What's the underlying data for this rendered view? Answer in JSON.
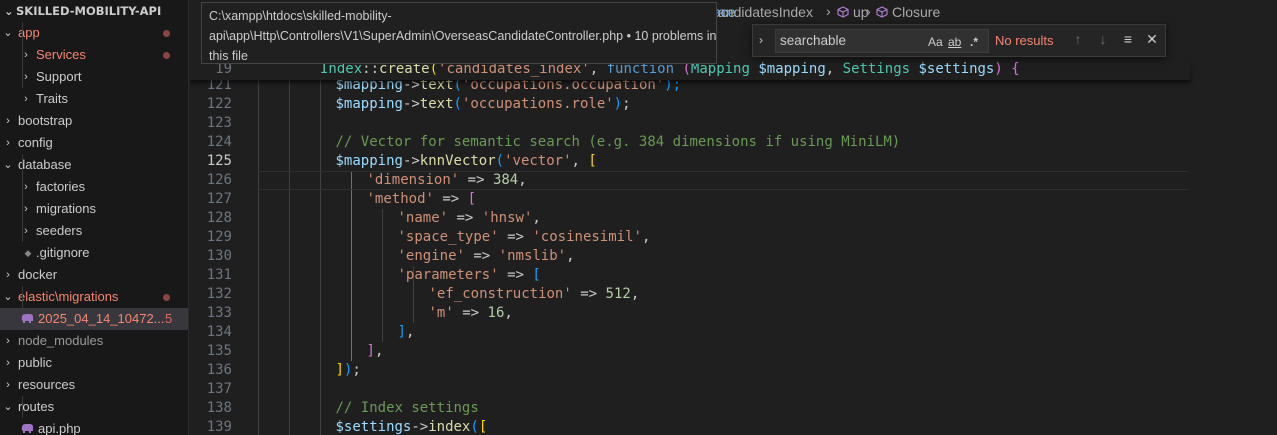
{
  "explorer": {
    "root_label": "SKILLED-MOBILITY-API",
    "items": [
      {
        "label": "app",
        "depth": 0,
        "state": "open",
        "tone": "red",
        "badge": "dot"
      },
      {
        "label": "Services",
        "depth": 1,
        "state": "closed",
        "tone": "red",
        "badge": "dot"
      },
      {
        "label": "Support",
        "depth": 1,
        "state": "closed",
        "tone": "normal",
        "badge": ""
      },
      {
        "label": "Traits",
        "depth": 1,
        "state": "closed",
        "tone": "normal",
        "badge": ""
      },
      {
        "label": "bootstrap",
        "depth": 0,
        "state": "closed",
        "tone": "normal",
        "badge": ""
      },
      {
        "label": "config",
        "depth": 0,
        "state": "closed",
        "tone": "normal",
        "badge": ""
      },
      {
        "label": "database",
        "depth": 0,
        "state": "open",
        "tone": "normal",
        "badge": ""
      },
      {
        "label": "factories",
        "depth": 1,
        "state": "closed",
        "tone": "normal",
        "badge": ""
      },
      {
        "label": "migrations",
        "depth": 1,
        "state": "closed",
        "tone": "normal",
        "badge": ""
      },
      {
        "label": "seeders",
        "depth": 1,
        "state": "closed",
        "tone": "normal",
        "badge": ""
      },
      {
        "label": ".gitignore",
        "depth": 1,
        "state": "file",
        "tone": "normal",
        "badge": ""
      },
      {
        "label": "docker",
        "depth": 0,
        "state": "closed",
        "tone": "normal",
        "badge": ""
      },
      {
        "label": "elastic\\migrations",
        "depth": 0,
        "state": "open",
        "tone": "red",
        "badge": "dot"
      },
      {
        "label": "2025_04_14_10472...",
        "depth": 1,
        "state": "php",
        "tone": "red",
        "badge": "5"
      },
      {
        "label": "node_modules",
        "depth": 0,
        "state": "closed",
        "tone": "muted",
        "badge": ""
      },
      {
        "label": "public",
        "depth": 0,
        "state": "closed",
        "tone": "normal",
        "badge": ""
      },
      {
        "label": "resources",
        "depth": 0,
        "state": "closed",
        "tone": "normal",
        "badge": ""
      },
      {
        "label": "routes",
        "depth": 0,
        "state": "open",
        "tone": "normal",
        "badge": ""
      },
      {
        "label": "api.php",
        "depth": 1,
        "state": "php",
        "tone": "normal",
        "badge": ""
      }
    ]
  },
  "breadcrumbs": {
    "partial_left": "ace",
    "items": [
      "andidatesIndex",
      "up",
      "Closure"
    ]
  },
  "tooltip": {
    "lines": [
      "C:\\xampp\\htdocs\\skilled-mobility-",
      "api\\app\\Http\\Controllers\\V1\\SuperAdmin\\OverseasCandidateController.php • 10 problems in",
      "this file"
    ]
  },
  "find": {
    "value": "searchable",
    "match_case_label": "Aa",
    "whole_word_label": "ab",
    "regex_label": ".*",
    "status": "No results"
  },
  "sticky": {
    "number": "19",
    "tokens": [
      {
        "t": "Index",
        "c": "cls"
      },
      {
        "t": "::",
        "c": "op"
      },
      {
        "t": "create",
        "c": "fn"
      },
      {
        "t": "(",
        "c": "br1"
      },
      {
        "t": "'candidates_index'",
        "c": "str"
      },
      {
        "t": ", ",
        "c": "op"
      },
      {
        "t": "function ",
        "c": "kw"
      },
      {
        "t": "(",
        "c": "br2"
      },
      {
        "t": "Mapping ",
        "c": "cls"
      },
      {
        "t": "$mapping",
        "c": "var"
      },
      {
        "t": ", ",
        "c": "op"
      },
      {
        "t": "Settings ",
        "c": "cls"
      },
      {
        "t": "$settings",
        "c": "var"
      },
      {
        "t": ") ",
        "c": "br2"
      },
      {
        "t": "{",
        "c": "br2"
      }
    ]
  },
  "code": [
    {
      "n": "121",
      "indent": 10,
      "tokens": [
        {
          "t": "$mapping",
          "c": "var"
        },
        {
          "t": "->",
          "c": "op"
        },
        {
          "t": "text",
          "c": "fn"
        },
        {
          "t": "(",
          "c": "br3"
        },
        {
          "t": "'occupations.occupation'",
          "c": "str"
        },
        {
          "t": ");",
          "c": "br3"
        }
      ]
    },
    {
      "n": "122",
      "indent": 10,
      "tokens": [
        {
          "t": "$mapping",
          "c": "var"
        },
        {
          "t": "->",
          "c": "op"
        },
        {
          "t": "text",
          "c": "fn"
        },
        {
          "t": "(",
          "c": "br3"
        },
        {
          "t": "'occupations.role'",
          "c": "str"
        },
        {
          "t": ")",
          "c": "br3"
        },
        {
          "t": ";",
          "c": "op"
        }
      ]
    },
    {
      "n": "123",
      "indent": 0,
      "tokens": []
    },
    {
      "n": "124",
      "indent": 10,
      "tokens": [
        {
          "t": "// Vector for semantic search (e.g. 384 dimensions if using MiniLM)",
          "c": "com"
        }
      ]
    },
    {
      "n": "125",
      "indent": 10,
      "tokens": [
        {
          "t": "$mapping",
          "c": "var"
        },
        {
          "t": "->",
          "c": "op"
        },
        {
          "t": "knnVector",
          "c": "fn"
        },
        {
          "t": "(",
          "c": "br3"
        },
        {
          "t": "'vector'",
          "c": "str"
        },
        {
          "t": ", ",
          "c": "op"
        },
        {
          "t": "[",
          "c": "br1"
        }
      ]
    },
    {
      "n": "126",
      "indent": 14,
      "tokens": [
        {
          "t": "'dimension'",
          "c": "str"
        },
        {
          "t": " => ",
          "c": "op"
        },
        {
          "t": "384",
          "c": "num"
        },
        {
          "t": ",",
          "c": "op"
        }
      ]
    },
    {
      "n": "127",
      "indent": 14,
      "tokens": [
        {
          "t": "'method'",
          "c": "str"
        },
        {
          "t": " => ",
          "c": "op"
        },
        {
          "t": "[",
          "c": "br2"
        }
      ]
    },
    {
      "n": "128",
      "indent": 18,
      "tokens": [
        {
          "t": "'name'",
          "c": "str"
        },
        {
          "t": " => ",
          "c": "op"
        },
        {
          "t": "'hnsw'",
          "c": "str"
        },
        {
          "t": ",",
          "c": "op"
        }
      ]
    },
    {
      "n": "129",
      "indent": 18,
      "tokens": [
        {
          "t": "'space_type'",
          "c": "str"
        },
        {
          "t": " => ",
          "c": "op"
        },
        {
          "t": "'cosinesimil'",
          "c": "str"
        },
        {
          "t": ",",
          "c": "op"
        }
      ]
    },
    {
      "n": "130",
      "indent": 18,
      "tokens": [
        {
          "t": "'engine'",
          "c": "str"
        },
        {
          "t": " => ",
          "c": "op"
        },
        {
          "t": "'nmslib'",
          "c": "str"
        },
        {
          "t": ",",
          "c": "op"
        }
      ]
    },
    {
      "n": "131",
      "indent": 18,
      "tokens": [
        {
          "t": "'parameters'",
          "c": "str"
        },
        {
          "t": " => ",
          "c": "op"
        },
        {
          "t": "[",
          "c": "br3"
        }
      ]
    },
    {
      "n": "132",
      "indent": 22,
      "tokens": [
        {
          "t": "'ef_construction'",
          "c": "str"
        },
        {
          "t": " => ",
          "c": "op"
        },
        {
          "t": "512",
          "c": "num"
        },
        {
          "t": ",",
          "c": "op"
        }
      ]
    },
    {
      "n": "133",
      "indent": 22,
      "tokens": [
        {
          "t": "'m'",
          "c": "str"
        },
        {
          "t": " => ",
          "c": "op"
        },
        {
          "t": "16",
          "c": "num"
        },
        {
          "t": ",",
          "c": "op"
        }
      ]
    },
    {
      "n": "134",
      "indent": 18,
      "tokens": [
        {
          "t": "]",
          "c": "br3"
        },
        {
          "t": ",",
          "c": "op"
        }
      ]
    },
    {
      "n": "135",
      "indent": 14,
      "tokens": [
        {
          "t": "]",
          "c": "br2"
        },
        {
          "t": ",",
          "c": "op"
        }
      ]
    },
    {
      "n": "136",
      "indent": 10,
      "tokens": [
        {
          "t": "]",
          "c": "br1"
        },
        {
          "t": ")",
          "c": "br3"
        },
        {
          "t": ";",
          "c": "op"
        }
      ]
    },
    {
      "n": "137",
      "indent": 0,
      "tokens": []
    },
    {
      "n": "138",
      "indent": 10,
      "tokens": [
        {
          "t": "// Index settings",
          "c": "com"
        }
      ]
    },
    {
      "n": "139",
      "indent": 10,
      "tokens": [
        {
          "t": "$settings",
          "c": "var"
        },
        {
          "t": "->",
          "c": "op"
        },
        {
          "t": "index",
          "c": "fn"
        },
        {
          "t": "(",
          "c": "br3"
        },
        {
          "t": "[",
          "c": "br1"
        }
      ]
    }
  ],
  "active_line": "125",
  "colors": {
    "error": "#f48771",
    "accent": "#007acc",
    "background": "#1f1f1f"
  },
  "icons": [
    "chevron-down-icon",
    "chevron-right-icon",
    "php-elephant-icon",
    "symbol-cube-icon",
    "arrow-up-icon",
    "arrow-down-icon",
    "filter-lines-icon",
    "close-icon"
  ]
}
